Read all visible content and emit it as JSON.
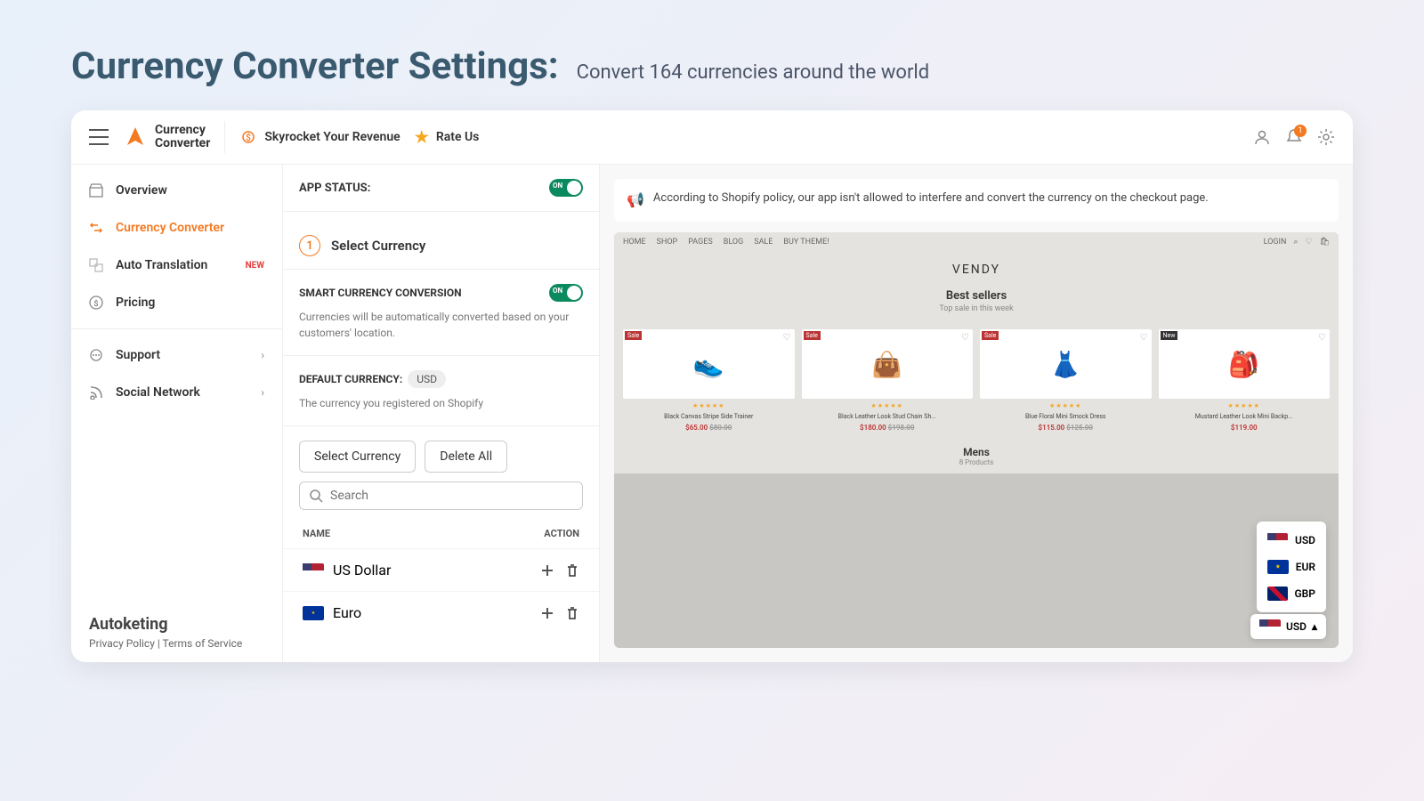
{
  "header": {
    "title": "Currency Converter Settings:",
    "subtitle": "Convert 164 currencies around the world"
  },
  "topbar": {
    "brand_line1": "Currency",
    "brand_line2": "Converter",
    "skyrocket": "Skyrocket Your Revenue",
    "rate_us": "Rate Us",
    "notif_count": "1"
  },
  "sidebar": {
    "items": [
      {
        "label": "Overview"
      },
      {
        "label": "Currency Converter"
      },
      {
        "label": "Auto Translation",
        "new": "NEW"
      },
      {
        "label": "Pricing"
      },
      {
        "label": "Support"
      },
      {
        "label": "Social Network"
      }
    ],
    "brand": "Autoketing",
    "legal": "Privacy Policy | Terms of Service"
  },
  "settings": {
    "app_status_label": "APP STATUS:",
    "toggle_on": "ON",
    "step_num": "1",
    "step_title": "Select Currency",
    "smart_title": "SMART CURRENCY CONVERSION",
    "smart_desc": "Currencies will be automatically converted based on your customers' location.",
    "default_label": "DEFAULT CURRENCY:",
    "default_value": "USD",
    "default_desc": "The currency you registered on Shopify",
    "select_btn": "Select Currency",
    "delete_btn": "Delete All",
    "search_placeholder": "Search",
    "col_name": "NAME",
    "col_action": "ACTION",
    "rows": [
      {
        "label": "US Dollar"
      },
      {
        "label": "Euro"
      }
    ]
  },
  "preview": {
    "notice": "According to Shopify policy, our app isn't allowed to interfere and convert the currency on the checkout page.",
    "nav": {
      "home": "HOME",
      "shop": "SHOP",
      "pages": "PAGES",
      "blog": "BLOG",
      "sale": "SALE",
      "buy": "BUY THEME!",
      "login": "LOGIN"
    },
    "brand": "VENDY",
    "section_title": "Best sellers",
    "section_sub": "Top sale in this week",
    "products": [
      {
        "name": "Black Canvas Stripe Side Trainer",
        "price": "$65.00",
        "old": "$80.00"
      },
      {
        "name": "Black Leather Look Stud Chain Sh...",
        "price": "$180.00",
        "old": "$198.00"
      },
      {
        "name": "Blue Floral Mini Smock Dress",
        "price": "$115.00",
        "old": "$125.00"
      },
      {
        "name": "Mustard Leather Look Mini Backp...",
        "price": "$119.00",
        "old": ""
      }
    ],
    "second_title": "Mens",
    "second_sub": "8 Products",
    "currencies": [
      {
        "code": "USD"
      },
      {
        "code": "EUR"
      },
      {
        "code": "GBP"
      }
    ],
    "selected": "USD"
  }
}
